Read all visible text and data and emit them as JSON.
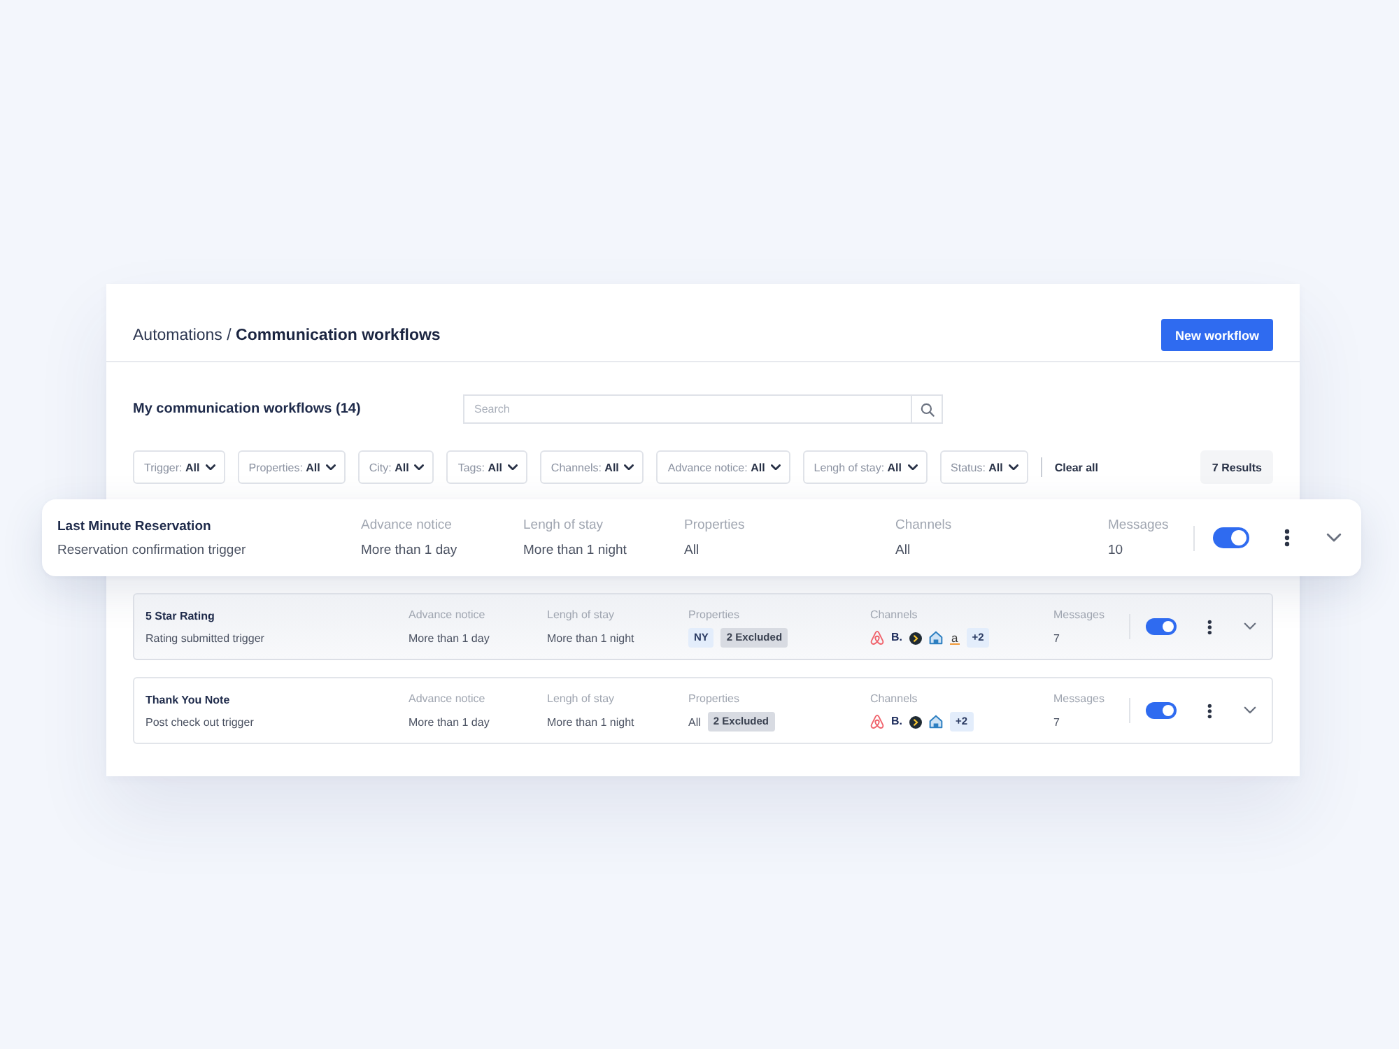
{
  "header": {
    "title": "Automations / **Communication workflows**",
    "button": "New workflow"
  },
  "toolbar": {
    "title": "My communication workflows (14)",
    "search_placeholder": "Search"
  },
  "filters": [
    "Trigger: **All**",
    "Properties: **All**",
    "City: **All**",
    "Tags: **All**",
    "Channels: **All**",
    "Advance notice: **All**",
    "Lengh of stay: **All**",
    "Status: **All**"
  ],
  "clear_all": "Clear all",
  "results": "7 Results",
  "workflows": [
    {
      "raised": true,
      "highlighted": false,
      "name": "Last Minute Reservation",
      "trigger": "Reservation confirmation trigger",
      "on": true,
      "columns": [
        {
          "label": "Advance notice",
          "items": [
            {
              "kind": "text",
              "text": "More than 1 day"
            }
          ]
        },
        {
          "label": "Lengh of stay",
          "items": [
            {
              "kind": "text",
              "text": "More than 1 night"
            }
          ]
        },
        {
          "label": "Properties",
          "items": [
            {
              "kind": "text",
              "text": "All"
            }
          ]
        },
        {
          "label": "Channels",
          "items": [
            {
              "kind": "text",
              "text": "All"
            }
          ]
        },
        {
          "label": "Messages",
          "items": [
            {
              "kind": "text",
              "text": "10"
            }
          ]
        }
      ]
    },
    {
      "raised": false,
      "highlighted": true,
      "name": "5 Star Rating",
      "trigger": "Rating submitted trigger",
      "on": true,
      "columns": [
        {
          "label": "Advance notice",
          "items": [
            {
              "kind": "text",
              "text": "More than 1 day"
            }
          ]
        },
        {
          "label": "Lengh of stay",
          "items": [
            {
              "kind": "text",
              "text": "More than 1 night"
            }
          ]
        },
        {
          "label": "Properties",
          "items": [
            {
              "kind": "tag",
              "text": "NY"
            },
            {
              "kind": "muted-tag",
              "text": "2 Excluded"
            }
          ]
        },
        {
          "label": "Channels",
          "items": [
            {
              "kind": "loop-logo"
            },
            {
              "kind": "letter-logo",
              "text": "B."
            },
            {
              "kind": "disc-logo"
            },
            {
              "kind": "house-logo"
            },
            {
              "kind": "underlined-letter-logo",
              "text": "a"
            },
            {
              "kind": "tag",
              "text": "+2"
            }
          ]
        },
        {
          "label": "Messages",
          "items": [
            {
              "kind": "text",
              "text": "7"
            }
          ]
        }
      ]
    },
    {
      "raised": false,
      "highlighted": false,
      "name": "Thank You Note",
      "trigger": "Post check out trigger",
      "on": true,
      "columns": [
        {
          "label": "Advance notice",
          "items": [
            {
              "kind": "text",
              "text": "More than 1 day"
            }
          ]
        },
        {
          "label": "Lengh of stay",
          "items": [
            {
              "kind": "text",
              "text": "More than 1 night"
            }
          ]
        },
        {
          "label": "Properties",
          "items": [
            {
              "kind": "text",
              "text": "All"
            },
            {
              "kind": "muted-tag",
              "text": "2 Excluded"
            }
          ]
        },
        {
          "label": "Channels",
          "items": [
            {
              "kind": "loop-logo"
            },
            {
              "kind": "letter-logo",
              "text": "B."
            },
            {
              "kind": "disc-logo"
            },
            {
              "kind": "house-logo"
            },
            {
              "kind": "tag",
              "text": "+2"
            }
          ]
        },
        {
          "label": "Messages",
          "items": [
            {
              "kind": "text",
              "text": "7"
            }
          ]
        }
      ]
    }
  ]
}
